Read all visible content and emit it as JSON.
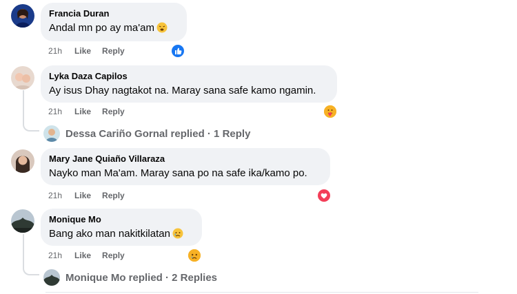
{
  "comments": [
    {
      "author": "Francia Duran",
      "text": "Andal mn po ay ma'am",
      "time": "21h",
      "like_label": "Like",
      "reply_label": "Reply",
      "reaction": "like-reaction-icon"
    },
    {
      "author": "Lyka Daza Capilos",
      "text": "Ay isus Dhay nagtakot na. Maray sana safe kamo ngamin.",
      "time": "21h",
      "like_label": "Like",
      "reply_label": "Reply",
      "reaction": "care-reaction-icon",
      "replies_summary": {
        "text": "Dessa Cariño Gornal replied · 1 Reply"
      }
    },
    {
      "author": "Mary Jane Quiaño Villaraza",
      "text": "Nayko man Ma'am. Maray sana po na safe ika/kamo po.",
      "time": "21h",
      "like_label": "Like",
      "reply_label": "Reply",
      "reaction": "love-reaction-icon"
    },
    {
      "author": "Monique Mo",
      "text": "Bang ako man nakitkilatan",
      "time": "21h",
      "like_label": "Like",
      "reply_label": "Reply",
      "reaction": "sad-reaction-icon",
      "replies_summary": {
        "text": "Monique Mo replied · 2 Replies"
      }
    }
  ],
  "colors": {
    "bubble": "#f0f2f5",
    "like_blue": "#1877f2",
    "love_red": "#f33e58",
    "meta_gray": "#65676b"
  }
}
